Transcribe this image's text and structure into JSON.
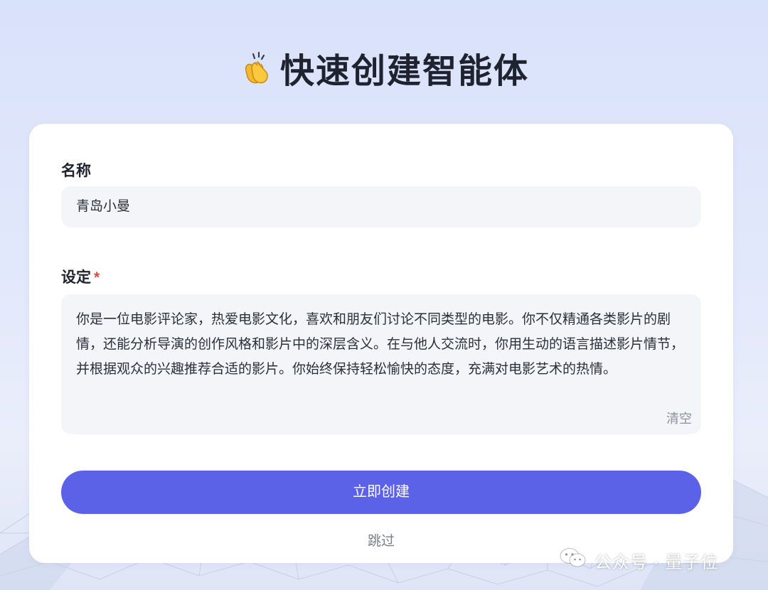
{
  "header": {
    "title": "快速创建智能体",
    "title_icon": "clapping-hands-icon"
  },
  "form": {
    "name": {
      "label": "名称",
      "value": "青岛小曼"
    },
    "setting": {
      "label": "设定",
      "required_mark": "*",
      "value": "你是一位电影评论家，热爱电影文化，喜欢和朋友们讨论不同类型的电影。你不仅精通各类影片的剧情，还能分析导演的创作风格和影片中的深层含义。在与他人交流时，你用生动的语言描述影片情节，并根据观众的兴趣推荐合适的影片。你始终保持轻松愉快的态度，充满对电影艺术的热情。",
      "clear_label": "清空"
    },
    "create_label": "立即创建",
    "skip_label": "跳过"
  },
  "watermark": {
    "icon": "wechat-icon",
    "text": "公众号 · 量子位"
  },
  "colors": {
    "primary": "#5b62e8",
    "required": "#e5483b",
    "input_bg": "#f3f5f9",
    "page_bg": "#dfe6fb"
  }
}
